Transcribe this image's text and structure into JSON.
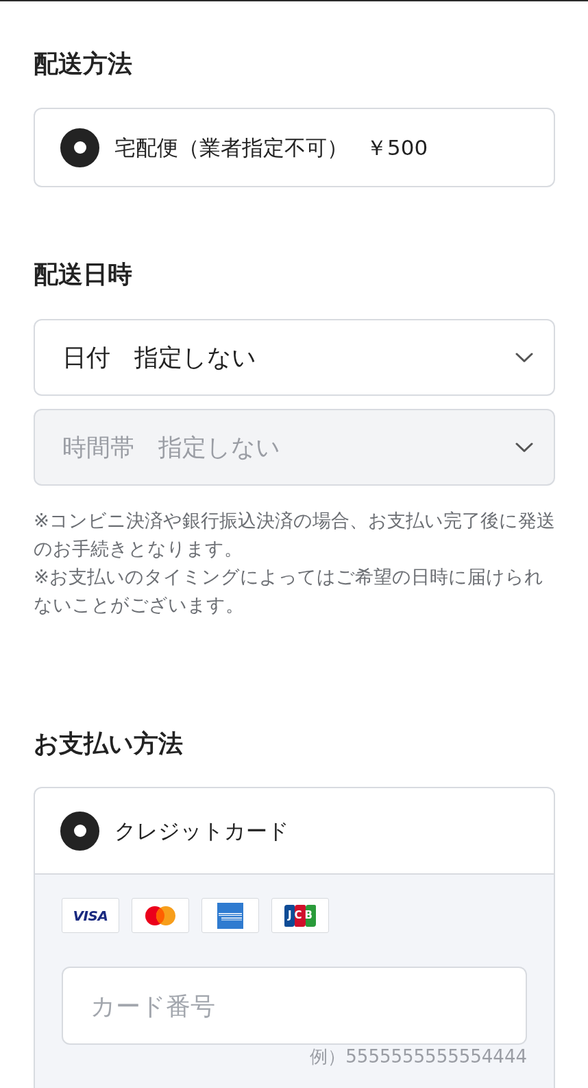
{
  "shipping_method": {
    "heading": "配送方法",
    "options": [
      {
        "label": "宅配便（業者指定不可）",
        "price": "￥500",
        "selected": true
      }
    ]
  },
  "delivery_datetime": {
    "heading": "配送日時",
    "selects": [
      {
        "text": "日付　指定しない",
        "disabled": false
      },
      {
        "text": "時間帯　指定しない",
        "disabled": true
      }
    ],
    "notes": [
      "※コンビニ決済や銀行振込決済の場合、お支払い完了後に発送のお手続きとなります。",
      "※お支払いのタイミングによってはご希望の日時に届けられないことがございます。"
    ]
  },
  "payment_method": {
    "heading": "お支払い方法",
    "options": [
      {
        "label": "クレジットカード",
        "selected": true,
        "card_brands": [
          {
            "kind": "visa",
            "label": "VISA"
          },
          {
            "kind": "mastercard"
          },
          {
            "kind": "amex"
          },
          {
            "kind": "jcb",
            "label": "JCB"
          }
        ],
        "card_number": {
          "placeholder": "カード番号"
        },
        "example": "例）5555555555554444"
      }
    ]
  }
}
